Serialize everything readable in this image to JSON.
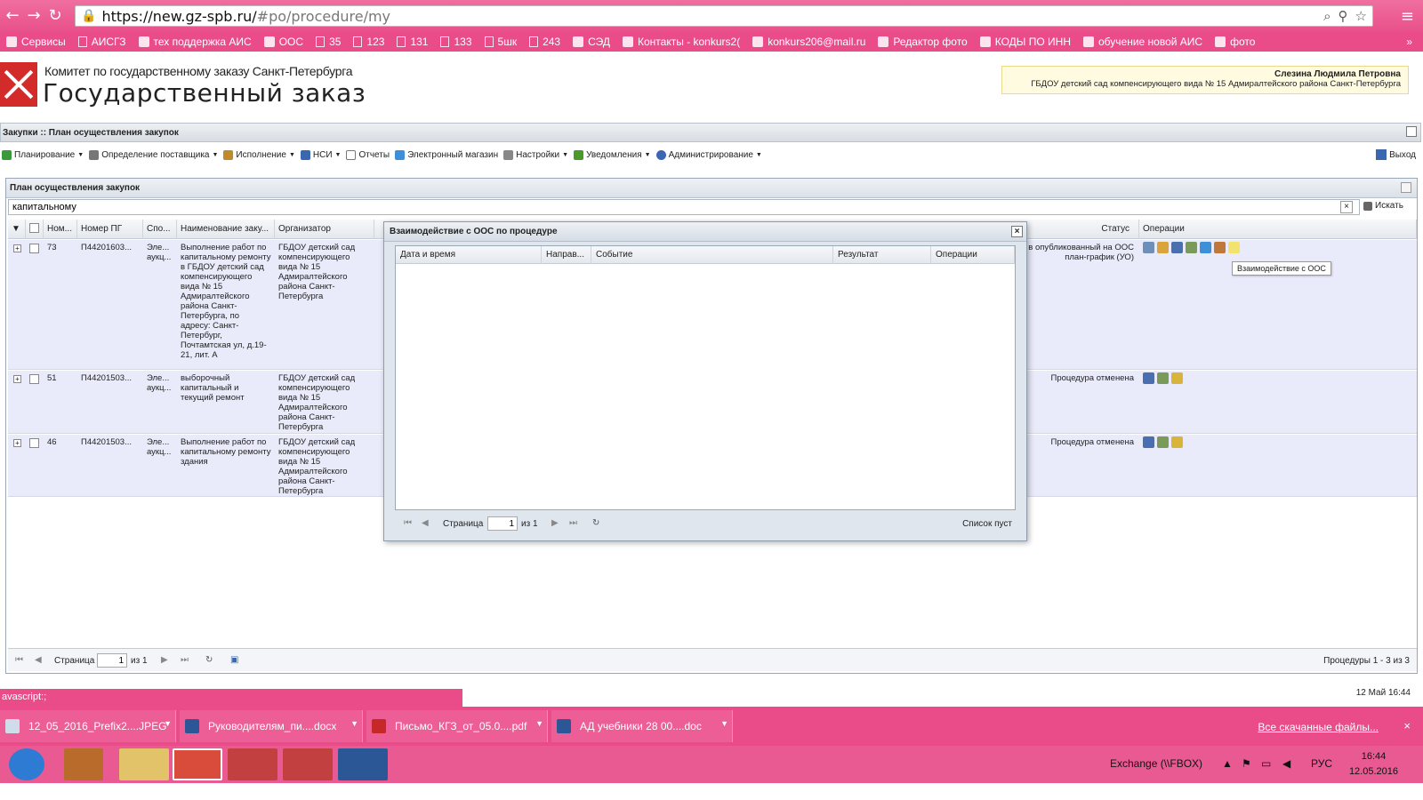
{
  "browser": {
    "url_host": "https://new.gz-spb.ru/",
    "url_path": "#po/procedure/my",
    "bookmarks": [
      "Сервисы",
      "АИСГЗ",
      "тех поддержка АИС",
      "ООС",
      "35",
      "123",
      "131",
      "133",
      "5шк",
      "243",
      "СЭД",
      "Контакты - konkurs2(",
      "konkurs206@mail.ru",
      "Редактор фото",
      "КОДЫ ПО ИНН",
      "обучение новой АИС",
      "фото"
    ],
    "more": "»"
  },
  "header": {
    "org_line1": "Комитет по государственному заказу Санкт-Петербурга",
    "org_line2": "Государственный заказ",
    "user_name": "Слезина Людмила Петровна",
    "user_org": "ГБДОУ детский сад компенсирующего вида № 15 Адмиралтейского района Санкт-Петербурга"
  },
  "titlebar": "Закупки :: План осуществления закупок",
  "menu": {
    "items": [
      "Планирование",
      "Определение поставщика",
      "Исполнение",
      "НСИ",
      "Отчеты",
      "Электронный магазин",
      "Настройки",
      "Уведомления",
      "Администрирование"
    ],
    "exit": "Выход"
  },
  "panel": {
    "title": "План осуществления закупок",
    "search_value": "капитальному",
    "search_button": "Искать",
    "columns": [
      "Ном...",
      "Номер ПГ",
      "Спо...",
      "Наименование заку...",
      "Организатор",
      "Статус",
      "Операции"
    ],
    "rows": [
      {
        "num": "73",
        "pg": "П44201603...",
        "method": "Эле... аукц...",
        "name": "Выполнение работ по капитальному ремонту в ГБДОУ детский сад компенсирующего вида № 15 Адмиралтейского района Санкт-Петербурга, по адресу: Санкт-Петербург, Почтамтская ул, д.19-21, лит. А",
        "org": "ГБДОУ детский сад компенсирующего вида № 15 Адмиралтейского района Санкт-Петербурга",
        "status": "на в опубликованный на ООС план-график (УО)"
      },
      {
        "num": "51",
        "pg": "П44201503...",
        "method": "Эле... аукц...",
        "name": "выборочный капитальный и текущий ремонт",
        "org": "ГБДОУ детский сад компенсирующего вида № 15 Адмиралтейского района Санкт-Петербурга",
        "status": "Процедура отменена"
      },
      {
        "num": "46",
        "pg": "П44201503...",
        "method": "Эле... аукц...",
        "name": "Выполнение работ по капитальному ремонту здания",
        "org": "ГБДОУ детский сад компенсирующего вида № 15 Адмиралтейского района Санкт-Петербурга",
        "status": "Процедура отменена"
      }
    ],
    "tooltip": "Взаимодействие с ООС",
    "pager": {
      "page_label": "Страница",
      "page": "1",
      "of": "из 1",
      "summary": "Процедуры 1 - 3 из 3"
    }
  },
  "dialog": {
    "title": "Взаимодействие с ООС по процедуре",
    "columns": [
      "Дата и время",
      "Направ...",
      "Событие",
      "Результат",
      "Операции"
    ],
    "pager": {
      "page_label": "Страница",
      "page": "1",
      "of": "из 1",
      "empty": "Список пуст"
    }
  },
  "status": {
    "js": "avascript:;",
    "datetime": "12 Май 16:44"
  },
  "downloads": {
    "items": [
      "12_05_2016_Prefix2....JPEG",
      "Руководителям_пи....docx",
      "Письмо_КГЗ_от_05.0....pdf",
      "АД учебники 28 00....doc"
    ],
    "all": "Все скачанные файлы...",
    "close": "×"
  },
  "taskbar": {
    "tray_text": "Exchange (\\\\FBOX)",
    "lang": "РУС",
    "time": "16:44",
    "date": "12.05.2016"
  },
  "colors": {
    "pink": "#ea4c8a",
    "row_bg": "#e9ebfb"
  }
}
